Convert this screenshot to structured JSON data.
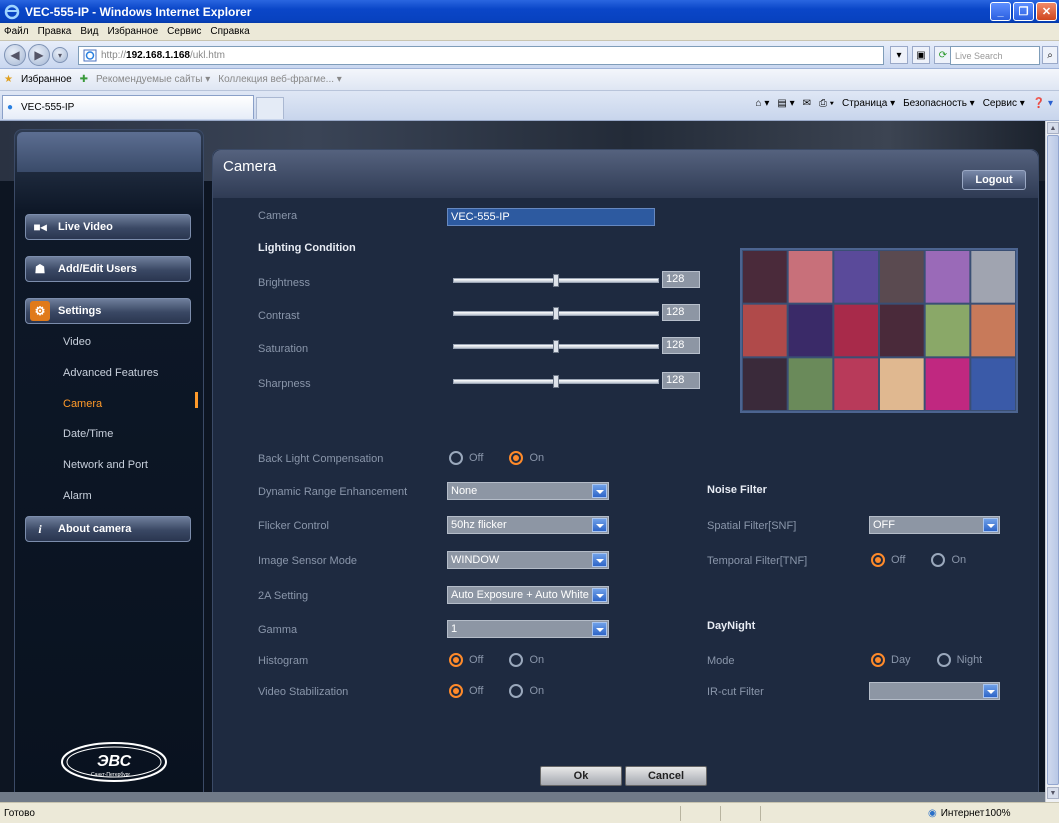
{
  "window": {
    "title": "VEC-555-IP - Windows Internet Explorer"
  },
  "menubar": [
    "Файл",
    "Правка",
    "Вид",
    "Избранное",
    "Сервис",
    "Справка"
  ],
  "address": {
    "prefix": "http://",
    "host": "192.168.1.168",
    "path": "/ukl.htm"
  },
  "search": {
    "placeholder": "Live Search"
  },
  "favorites": {
    "label": "Избранное",
    "items": [
      "Рекомендуемые сайты ▾",
      "Коллекция веб-фрагме... ▾"
    ]
  },
  "tab": {
    "title": "VEC-555-IP"
  },
  "commands": [
    "Страница ▾",
    "Безопасность ▾",
    "Сервис ▾"
  ],
  "sidebar": {
    "menu": [
      {
        "label": "Live Video",
        "icon": "video-camera-icon"
      },
      {
        "label": "Add/Edit Users",
        "icon": "user-icon"
      },
      {
        "label": "Settings",
        "icon": "settings-gear-icon"
      },
      {
        "label": "About camera",
        "icon": "info-icon"
      }
    ],
    "settings_items": [
      "Video",
      "Advanced Features",
      "Camera",
      "Date/Time",
      "Network and Port",
      "Alarm"
    ],
    "active_item": "Camera"
  },
  "page": {
    "title": "Camera",
    "logout": "Logout",
    "camera_label": "Camera",
    "camera_value": "VEC-555-IP",
    "lighting_heading": "Lighting Condition",
    "sliders": [
      {
        "label": "Brightness",
        "value": "128",
        "level": 0.5
      },
      {
        "label": "Contrast",
        "value": "128",
        "level": 0.5
      },
      {
        "label": "Saturation",
        "value": "128",
        "level": 0.5
      },
      {
        "label": "Sharpness",
        "value": "128",
        "level": 0.5
      }
    ],
    "backlight": {
      "label": "Back Light Compensation",
      "off": "Off",
      "on": "On",
      "selected": "on"
    },
    "dre": {
      "label": "Dynamic Range Enhancement",
      "value": "None"
    },
    "flicker": {
      "label": "Flicker Control",
      "value": "50hz flicker"
    },
    "sensor_mode": {
      "label": "Image Sensor Mode",
      "value": "WINDOW"
    },
    "twoa": {
      "label": "2A Setting",
      "value": "Auto Exposure + Auto White"
    },
    "gamma": {
      "label": "Gamma",
      "value": "1"
    },
    "histogram": {
      "label": "Histogram",
      "off": "Off",
      "on": "On",
      "selected": "off"
    },
    "stabilization": {
      "label": "Video Stabilization",
      "off": "Off",
      "on": "On",
      "selected": "off"
    },
    "noise_heading": "Noise Filter",
    "snf": {
      "label": "Spatial Filter[SNF]",
      "value": "OFF"
    },
    "tnf": {
      "label": "Temporal Filter[TNF]",
      "off": "Off",
      "on": "On",
      "selected": "off"
    },
    "daynight_heading": "DayNight",
    "mode": {
      "label": "Mode",
      "day": "Day",
      "night": "Night",
      "selected": "day"
    },
    "ircut": {
      "label": "IR-cut Filter",
      "value": ""
    },
    "ok": "Ok",
    "cancel": "Cancel"
  },
  "preview_colors": [
    [
      "#4a2a3a",
      "#c8707a",
      "#5a4a9a",
      "#5a4a50",
      "#9a6ab8",
      "#a0a4b0"
    ],
    [
      "#b04a4a",
      "#3a2a68",
      "#a82a4a",
      "#4a2a3a",
      "#8aa868",
      "#c87a5a"
    ],
    [
      "#3a2a3a",
      "#6a8a5a",
      "#b83a5a",
      "#e0b890",
      "#c02880",
      "#3a5aa8"
    ]
  ],
  "logo": {
    "text": "ЭВС",
    "sub": "Санкт-Петербург"
  },
  "status": {
    "left": "Готово",
    "zone": "Интернет",
    "zoom": "100%"
  }
}
